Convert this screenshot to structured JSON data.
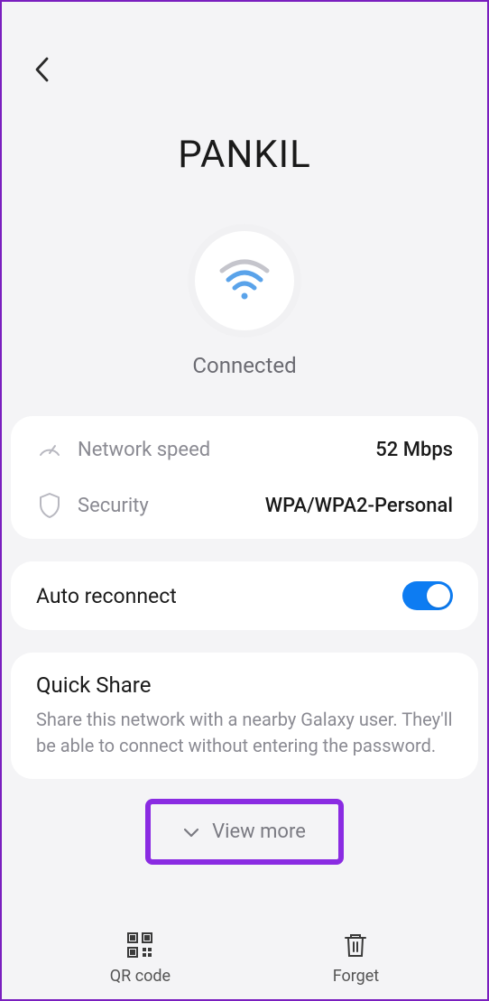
{
  "network": {
    "name": "PANKIL",
    "status": "Connected"
  },
  "details": {
    "speed_label": "Network speed",
    "speed_value": "52 Mbps",
    "security_label": "Security",
    "security_value": "WPA/WPA2-Personal"
  },
  "auto_reconnect": {
    "label": "Auto reconnect",
    "enabled": true
  },
  "quick_share": {
    "title": "Quick Share",
    "description": "Share this network with a nearby Galaxy user. They'll be able to connect without entering the password."
  },
  "view_more": {
    "label": "View more"
  },
  "bottom": {
    "qr_label": "QR code",
    "forget_label": "Forget"
  }
}
